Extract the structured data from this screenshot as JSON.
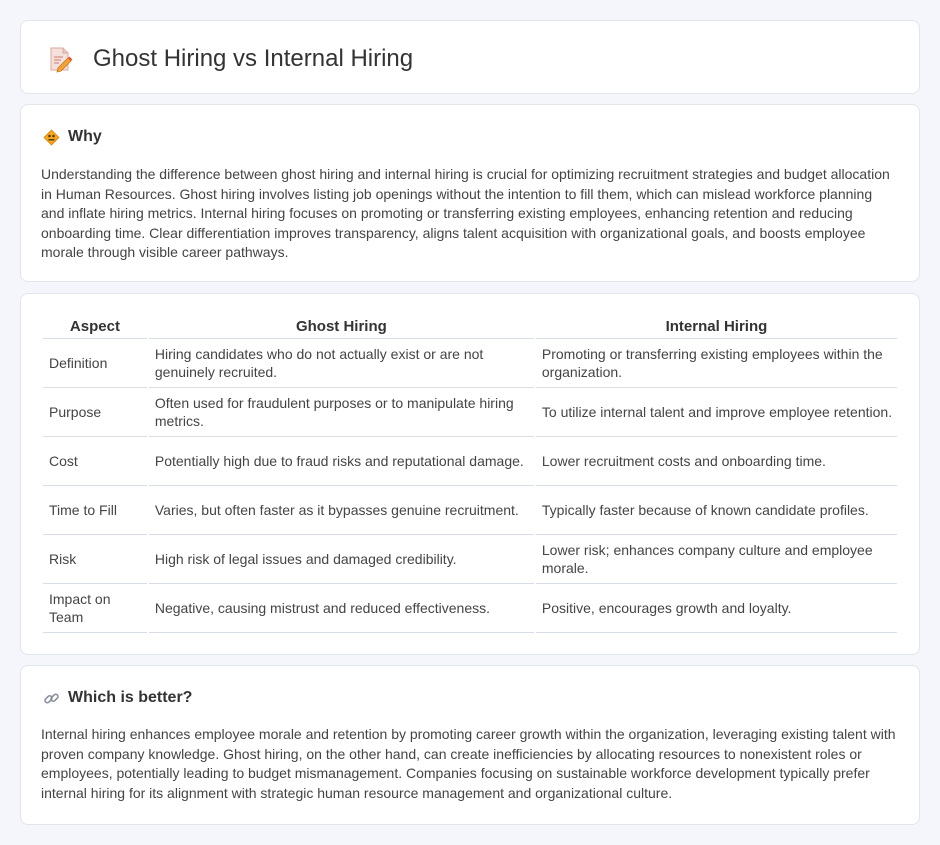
{
  "header": {
    "title": "Ghost Hiring vs Internal Hiring",
    "icon": "document-pencil-icon"
  },
  "why": {
    "heading": "Why",
    "icon": "diamond-sign-icon",
    "text": "Understanding the difference between ghost hiring and internal hiring is crucial for optimizing recruitment strategies and budget allocation in Human Resources. Ghost hiring involves listing job openings without the intention to fill them, which can mislead workforce planning and inflate hiring metrics. Internal hiring focuses on promoting or transferring existing employees, enhancing retention and reducing onboarding time. Clear differentiation improves transparency, aligns talent acquisition with organizational goals, and boosts employee morale through visible career pathways."
  },
  "comparison": {
    "headers": [
      "Aspect",
      "Ghost Hiring",
      "Internal Hiring"
    ],
    "rows": [
      [
        "Definition",
        "Hiring candidates who do not actually exist or are not genuinely recruited.",
        "Promoting or transferring existing employees within the organization."
      ],
      [
        "Purpose",
        "Often used for fraudulent purposes or to manipulate hiring metrics.",
        "To utilize internal talent and improve employee retention."
      ],
      [
        "Cost",
        "Potentially high due to fraud risks and reputational damage.",
        "Lower recruitment costs and onboarding time."
      ],
      [
        "Time to Fill",
        "Varies, but often faster as it bypasses genuine recruitment.",
        "Typically faster because of known candidate profiles."
      ],
      [
        "Risk",
        "High risk of legal issues and damaged credibility.",
        "Lower risk; enhances company culture and employee morale."
      ],
      [
        "Impact on Team",
        "Negative, causing mistrust and reduced effectiveness.",
        "Positive, encourages growth and loyalty."
      ]
    ]
  },
  "better": {
    "heading": "Which is better?",
    "icon": "link-icon",
    "text": "Internal hiring enhances employee morale and retention by promoting career growth within the organization, leveraging existing talent with proven company knowledge. Ghost hiring, on the other hand, can create inefficiencies by allocating resources to nonexistent roles or employees, potentially leading to budget mismanagement. Companies focusing on sustainable workforce development typically prefer internal hiring for its alignment with strategic human resource management and organizational culture."
  },
  "colors": {
    "background": "#f4f6fb",
    "card": "#ffffff",
    "border": "#e2e5ec",
    "icon_orange": "#f0a030",
    "icon_red": "#e05a4a"
  }
}
